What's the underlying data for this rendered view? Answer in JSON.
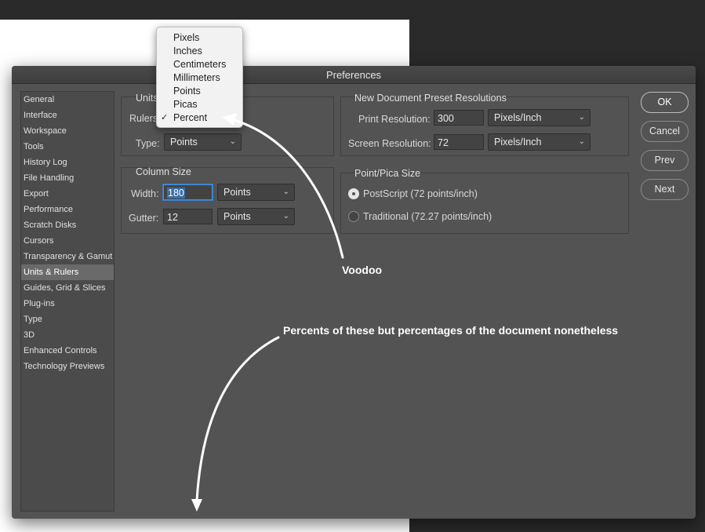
{
  "dialog": {
    "title": "Preferences"
  },
  "sidebar": {
    "items": [
      {
        "label": "General"
      },
      {
        "label": "Interface"
      },
      {
        "label": "Workspace"
      },
      {
        "label": "Tools"
      },
      {
        "label": "History Log"
      },
      {
        "label": "File Handling"
      },
      {
        "label": "Export"
      },
      {
        "label": "Performance"
      },
      {
        "label": "Scratch Disks"
      },
      {
        "label": "Cursors"
      },
      {
        "label": "Transparency & Gamut"
      },
      {
        "label": "Units & Rulers"
      },
      {
        "label": "Guides, Grid & Slices"
      },
      {
        "label": "Plug-ins"
      },
      {
        "label": "Type"
      },
      {
        "label": "3D"
      },
      {
        "label": "Enhanced Controls"
      },
      {
        "label": "Technology Previews"
      }
    ],
    "selected": "Units & Rulers"
  },
  "units": {
    "group_label": "Units",
    "rulers_label": "Rulers",
    "type_label": "Type:",
    "type_value": "Points"
  },
  "units_menu": {
    "options": [
      "Pixels",
      "Inches",
      "Centimeters",
      "Millimeters",
      "Points",
      "Picas",
      "Percent"
    ],
    "selected": "Percent",
    "check_glyph": "✓"
  },
  "column_size": {
    "group_label": "Column Size",
    "width_label": "Width:",
    "width_value": "180",
    "width_unit": "Points",
    "gutter_label": "Gutter:",
    "gutter_value": "12",
    "gutter_unit": "Points"
  },
  "preset_resolutions": {
    "group_label": "New Document Preset Resolutions",
    "print_label": "Print Resolution:",
    "print_value": "300",
    "print_unit": "Pixels/Inch",
    "screen_label": "Screen Resolution:",
    "screen_value": "72",
    "screen_unit": "Pixels/Inch"
  },
  "point_pica": {
    "group_label": "Point/Pica Size",
    "postscript_label": "PostScript (72 points/inch)",
    "traditional_label": "Traditional (72.27 points/inch)",
    "selected": "postscript"
  },
  "buttons": {
    "ok": "OK",
    "cancel": "Cancel",
    "prev": "Prev",
    "next": "Next"
  },
  "annotations": {
    "voodoo": "Voodoo",
    "percents": "Percents of these but percentages of the document nonetheless"
  },
  "icons": {
    "select_chevron": "chevron-down-icon"
  }
}
